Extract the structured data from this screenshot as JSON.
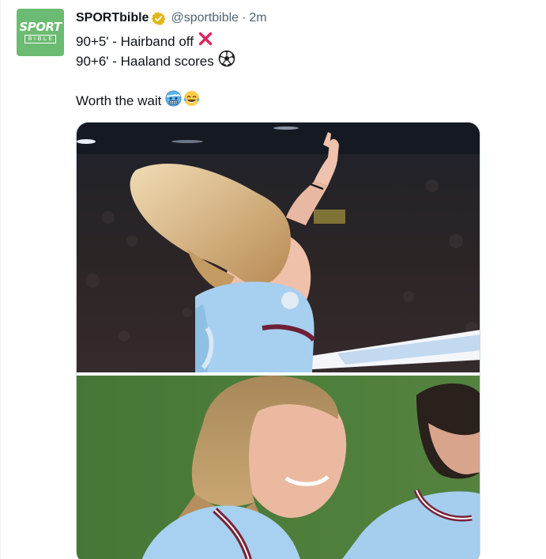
{
  "tweet": {
    "display_name": "SPORTbible",
    "handle": "@sportbible",
    "separator": "·",
    "time": "2m",
    "lines": [
      "90+5' - Hairband off",
      "90+6' - Haaland scores",
      "Worth the wait"
    ]
  },
  "avatar": {
    "brand_word_1": "SPORT",
    "brand_word_2": "BIBLE",
    "color": "#6cbb72"
  },
  "icons": {
    "verified": "verified-badge-icon",
    "emoji_line1": "cross-mark-emoji",
    "emoji_line2": "soccer-ball-emoji",
    "emoji_line3a": "cold-face-emoji",
    "emoji_line3b": "tears-of-joy-emoji"
  },
  "colors": {
    "text": "#0f1419",
    "secondary": "#536471",
    "verified_gold": "#e2b719",
    "jersey_blue": "#9cc8ea",
    "pitch_green": "#4f7e3b"
  }
}
